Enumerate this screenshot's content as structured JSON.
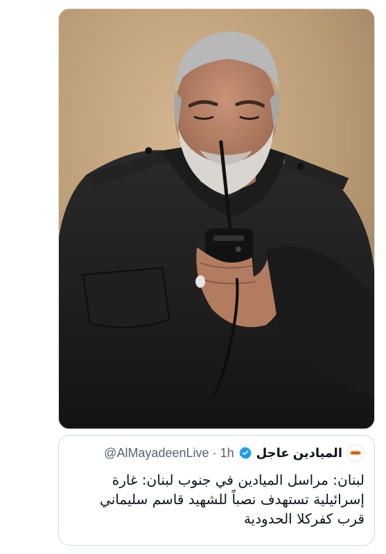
{
  "media": {
    "alt_icon": "photo"
  },
  "quote": {
    "display_name": "الميادين عاجل",
    "handle": "@AlMayadeenLive",
    "separator": "·",
    "time": "1h",
    "text": "لبنان: مراسل الميادين في جنوب لبنان: غارة إسرائيلية تستهدف نصباً للشهيد قاسم سليماني قرب كفركلا الحدودية",
    "avatar_label": "عاجل",
    "colors": {
      "verified": "#1d9bf0",
      "avatar_accent": "#e8a33d"
    }
  }
}
